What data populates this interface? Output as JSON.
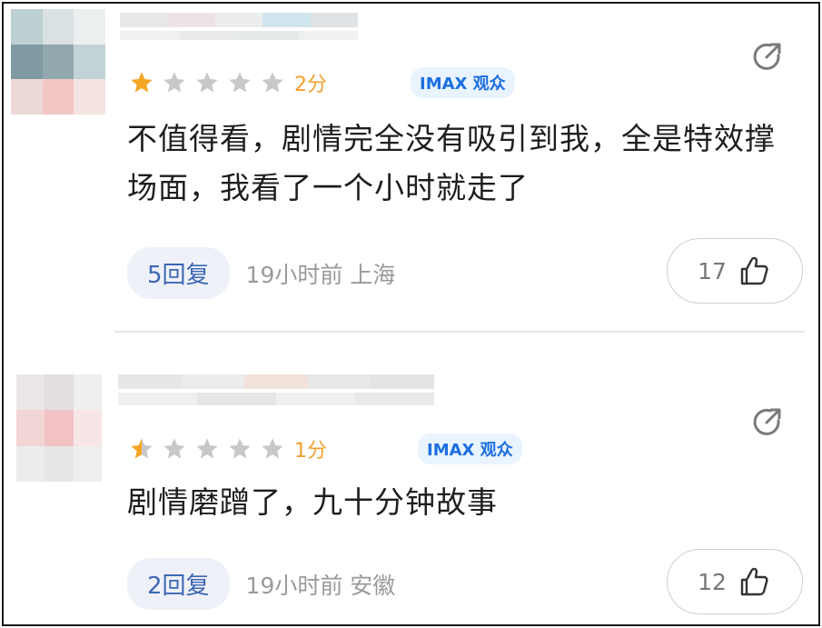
{
  "comments": [
    {
      "rating_stars": 1,
      "score_label": "2分",
      "badge_label": "IMAX 观众",
      "text": "不值得看，剧情完全没有吸引到我，全是特效撑场面，我看了一个小时就走了",
      "reply_label": "5回复",
      "meta": "19小时前 上海",
      "like_count": "17"
    },
    {
      "rating_stars": 0.5,
      "score_label": "1分",
      "badge_label": "IMAX 观众",
      "text": "剧情磨蹭了，九十分钟故事",
      "reply_label": "2回复",
      "meta": "19小时前 安徽",
      "like_count": "12"
    }
  ],
  "colors": {
    "star_filled": "#f5a623",
    "star_empty": "#c8c8c8",
    "badge_text": "#1c6fe0",
    "reply_text": "#3e66b5"
  },
  "icons": {
    "share": "share-icon",
    "like": "thumb-up-icon",
    "star": "star-icon"
  }
}
